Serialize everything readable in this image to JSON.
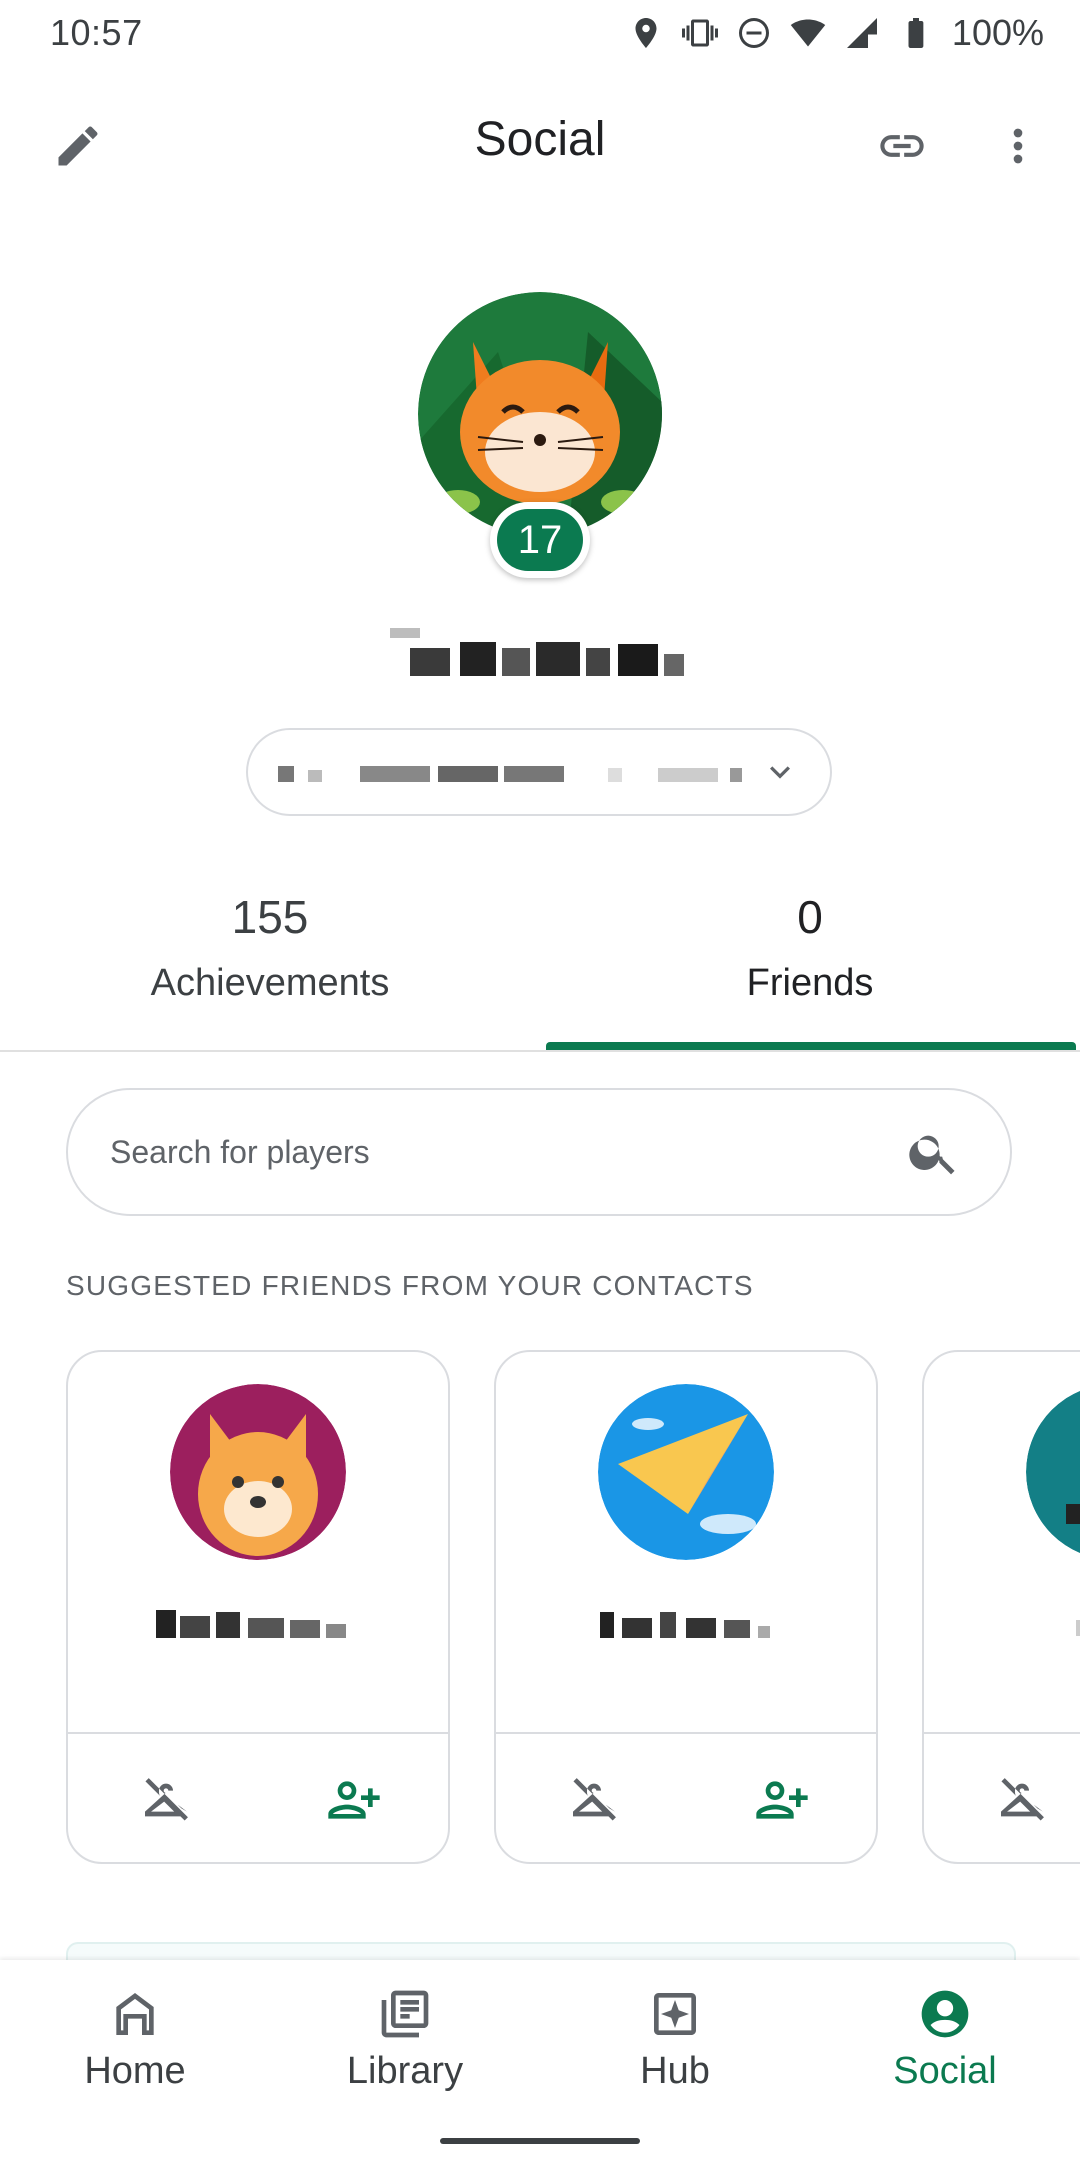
{
  "status_bar": {
    "time": "10:57",
    "battery": "100%",
    "icons": [
      "location-icon",
      "vibrate-icon",
      "do-not-disturb-icon",
      "wifi-icon",
      "signal-icon",
      "battery-icon"
    ]
  },
  "app_bar": {
    "title": "Social",
    "left_icon": "edit-icon",
    "right_icons": [
      "link-icon",
      "more-vert-icon"
    ]
  },
  "profile": {
    "level": "17",
    "name": "",
    "account": ""
  },
  "tabs": [
    {
      "count": "155",
      "label": "Achievements",
      "active": false
    },
    {
      "count": "0",
      "label": "Friends",
      "active": true
    }
  ],
  "search": {
    "placeholder": "Search for players"
  },
  "suggested": {
    "heading": "SUGGESTED FRIENDS FROM YOUR CONTACTS",
    "cards": [
      {
        "name": "",
        "avatar": "dog-avatar"
      },
      {
        "name": "",
        "avatar": "paper-plane-avatar"
      },
      {
        "name": "",
        "avatar": "partial-avatar"
      }
    ]
  },
  "bottom_nav": [
    {
      "label": "Home",
      "icon": "home-icon",
      "active": false
    },
    {
      "label": "Library",
      "icon": "library-icon",
      "active": false
    },
    {
      "label": "Hub",
      "icon": "hub-icon",
      "active": false
    },
    {
      "label": "Social",
      "icon": "social-icon",
      "active": true
    }
  ],
  "colors": {
    "accent": "#0b7a50",
    "text": "#202124",
    "muted": "#5f6368",
    "border": "#dadce0"
  }
}
